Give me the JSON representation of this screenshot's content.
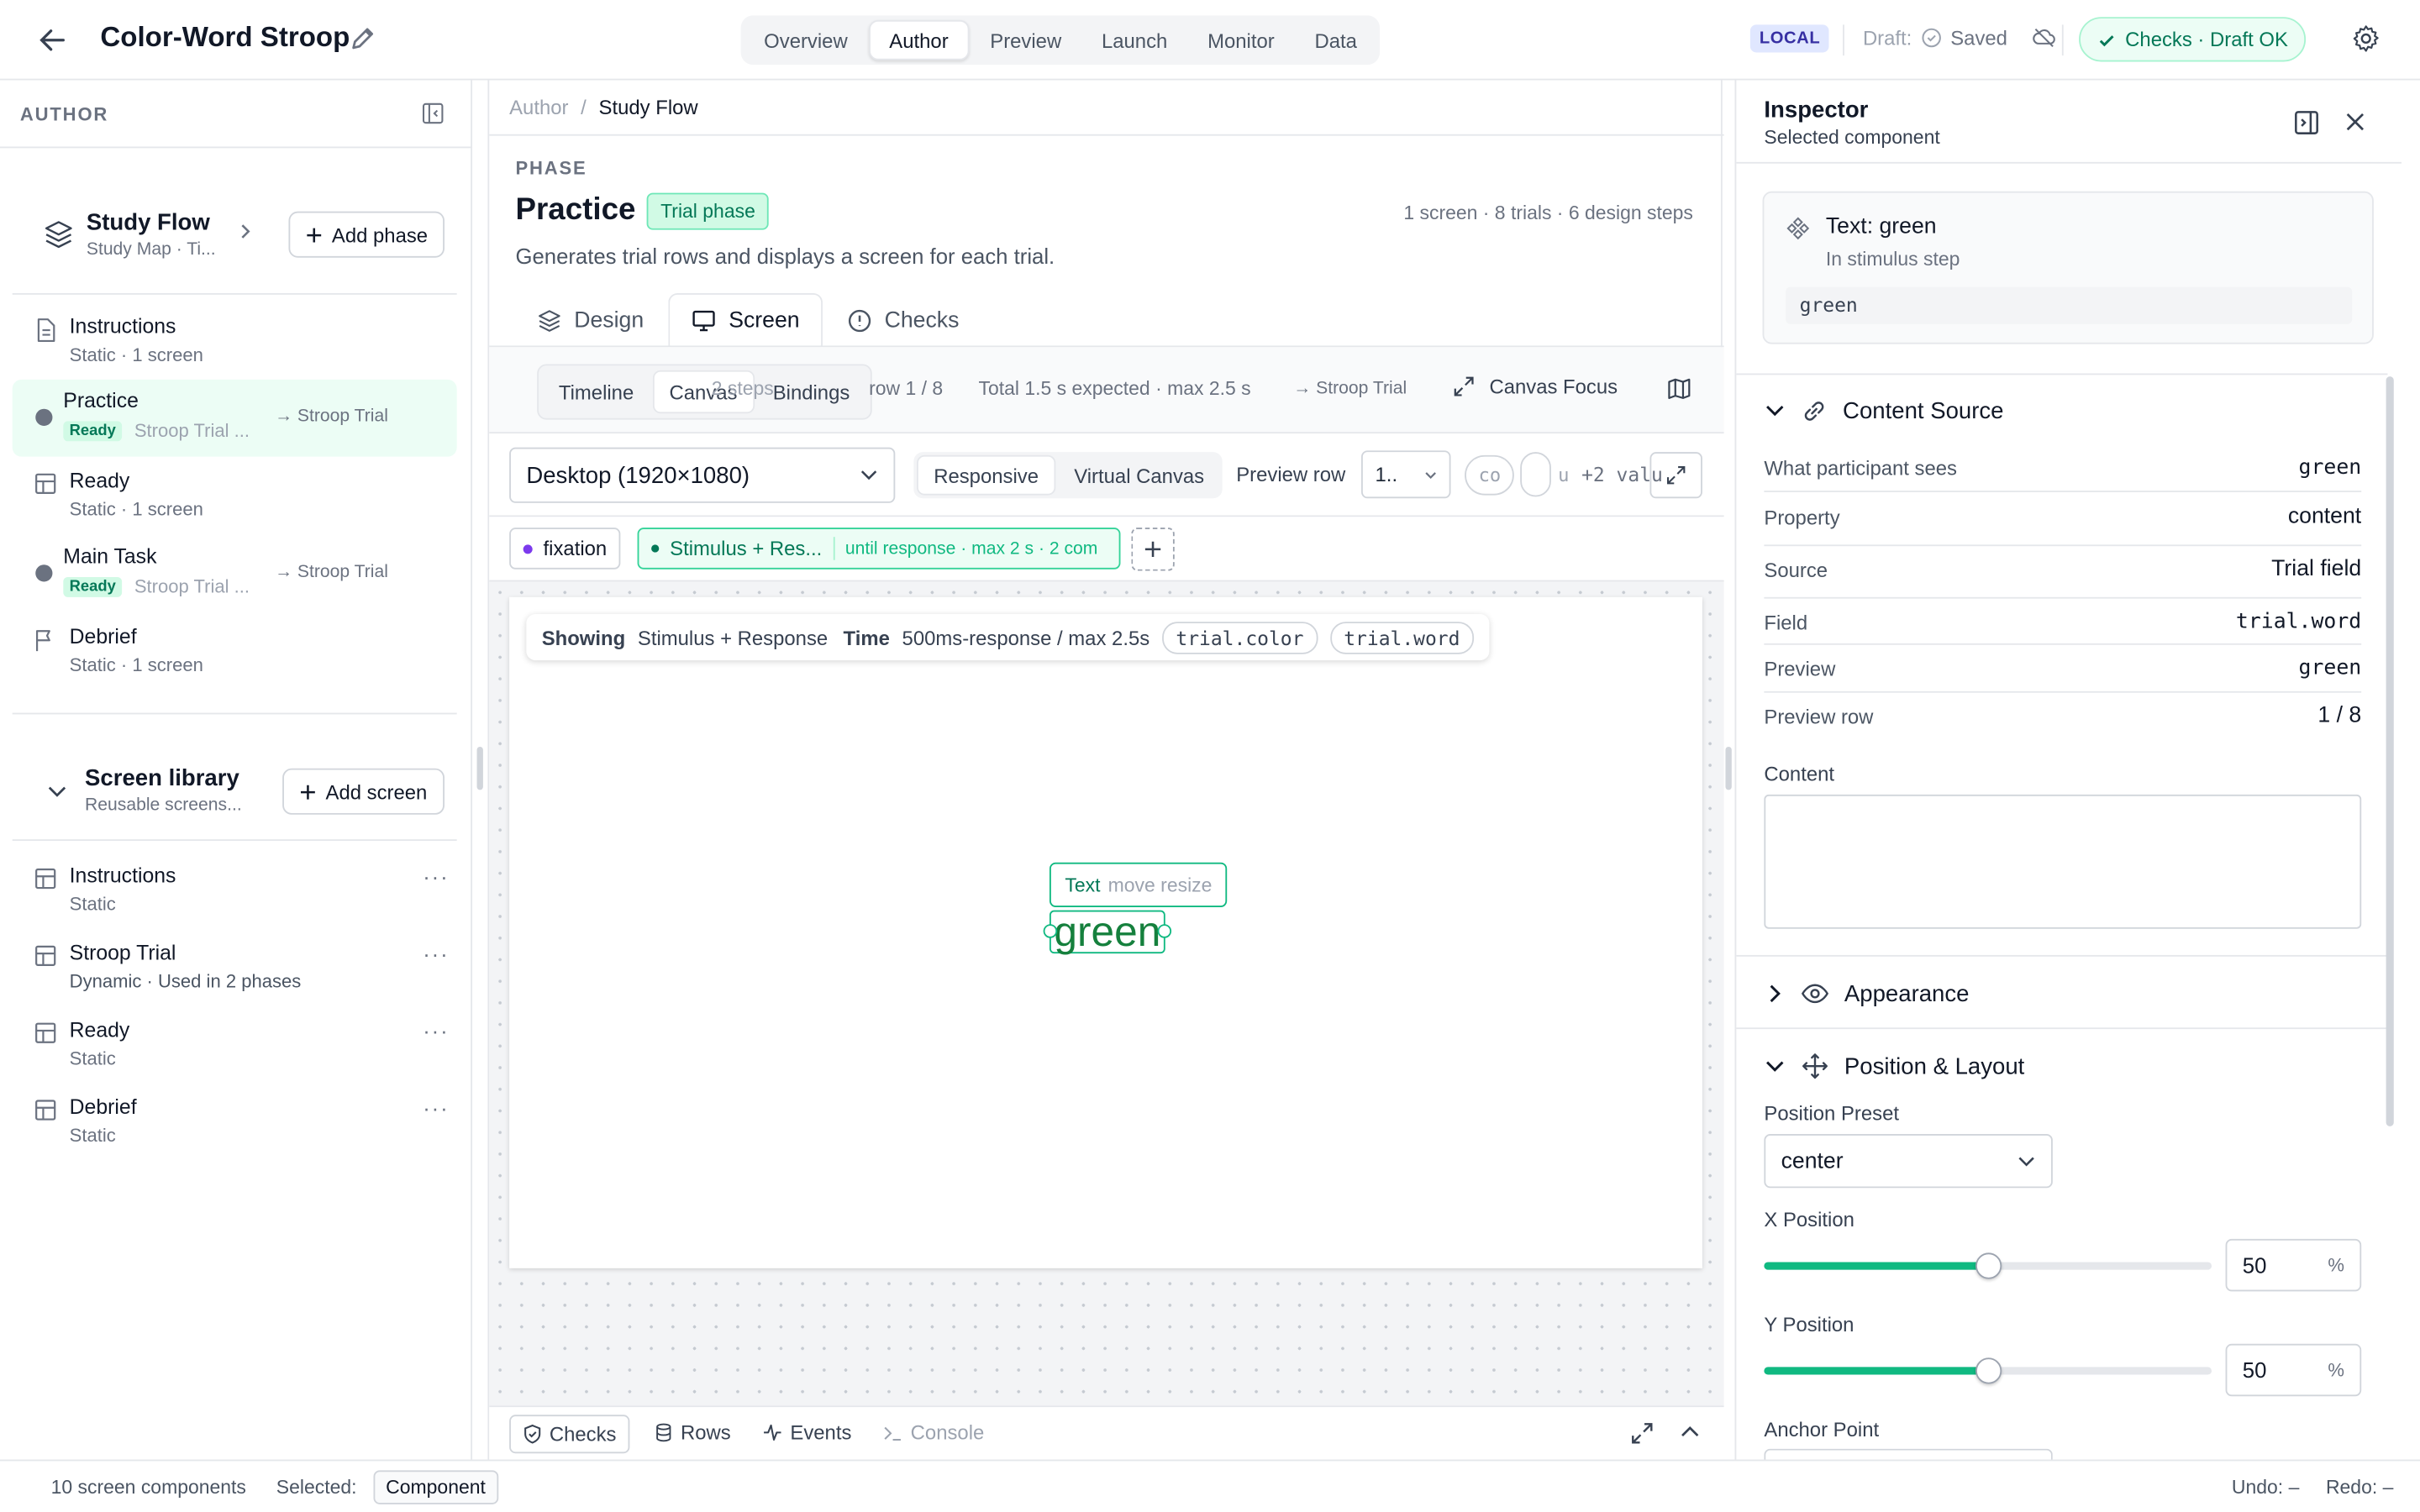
{
  "app": {
    "title": "Color-Word Stroop",
    "nav_tabs": [
      "Overview",
      "Author",
      "Preview",
      "Launch",
      "Monitor",
      "Data"
    ],
    "active_tab": "Author",
    "env_badge": "LOCAL",
    "draft_label": "Draft:",
    "saved_label": "Saved",
    "checks_label": "Checks · Draft OK"
  },
  "sidebar": {
    "header": "AUTHOR",
    "study_flow": {
      "title": "Study Flow",
      "subtitle": "Study Map · Ti...",
      "add_label": "Add phase"
    },
    "phases": [
      {
        "title": "Instructions",
        "subtitle": "Static · 1 screen",
        "icon": "document-icon"
      },
      {
        "title": "Practice",
        "badge": "Ready",
        "subtitle": "Stroop Trial ...",
        "link": "→ Stroop Trial",
        "icon": "dot-icon"
      },
      {
        "title": "Ready",
        "subtitle": "Static · 1 screen",
        "icon": "layout-icon"
      },
      {
        "title": "Main Task",
        "badge": "Ready",
        "subtitle": "Stroop Trial ...",
        "link": "→ Stroop Trial",
        "icon": "dot-icon"
      },
      {
        "title": "Debrief",
        "subtitle": "Static · 1 screen",
        "icon": "flag-icon"
      }
    ],
    "library": {
      "title": "Screen library",
      "subtitle": "Reusable screens...",
      "add_label": "Add screen",
      "items": [
        {
          "title": "Instructions",
          "subtitle": "Static"
        },
        {
          "title": "Stroop Trial",
          "subtitle": "Dynamic · Used in 2 phases"
        },
        {
          "title": "Ready",
          "subtitle": "Static"
        },
        {
          "title": "Debrief",
          "subtitle": "Static"
        }
      ]
    }
  },
  "center": {
    "breadcrumb": [
      "Author",
      "Study Flow"
    ],
    "kicker": "PHASE",
    "title": "Practice",
    "badge": "Trial phase",
    "stats": "1 screen · 8 trials · 6 design steps",
    "description": "Generates trial rows and displays a screen for each trial.",
    "subtabs": [
      "Design",
      "Screen",
      "Checks"
    ],
    "active_subtab": "Screen",
    "toolbar": {
      "seg": [
        "Timeline",
        "Canvas",
        "Bindings"
      ],
      "active_seg": "Canvas",
      "steps_text": "2 steps",
      "row_text": "row 1 / 8",
      "total_text": "Total 1.5 s expected · max 2.5 s",
      "link_text": "→ Stroop Trial",
      "focus_label": "Canvas Focus"
    },
    "display": {
      "device": "Desktop (1920×1080)",
      "responsive": "Responsive",
      "virtual": "Virtual Canvas",
      "preview_row_label": "Preview row",
      "preview_row_value": "1..",
      "truncated_1": "co",
      "truncated_2": "u",
      "more_values": "+2 valu"
    },
    "steps": {
      "fixation": "fixation",
      "stimulus": "Stimulus + Res...",
      "stimulus_meta": "until response · max 2 s · 2 com"
    },
    "canvas": {
      "showing_label": "Showing",
      "showing_value": "Stimulus + Response",
      "time_label": "Time",
      "time_value": "500ms-response / max 2.5s",
      "chips": [
        "trial.color",
        "trial.word"
      ],
      "text_handle": "Text",
      "text_handle_hint": "move resize",
      "stimulus_text": "green"
    },
    "bottom_tabs": [
      "Checks",
      "Rows",
      "Events",
      "Console"
    ]
  },
  "inspector": {
    "title": "Inspector",
    "subtitle": "Selected component",
    "component": {
      "name": "Text: green",
      "context": "In stimulus step",
      "value": "green"
    },
    "content_source": {
      "title": "Content Source",
      "rows": [
        {
          "label": "What participant sees",
          "value": "green"
        },
        {
          "label": "Property",
          "value": "content"
        },
        {
          "label": "Source",
          "value": "Trial field"
        },
        {
          "label": "Field",
          "value": "trial.word"
        },
        {
          "label": "Preview",
          "value": "green"
        },
        {
          "label": "Preview row",
          "value": "1 / 8"
        }
      ],
      "content_label": "Content"
    },
    "appearance_title": "Appearance",
    "position": {
      "title": "Position & Layout",
      "preset_label": "Position Preset",
      "preset_value": "center",
      "x_label": "X Position",
      "x_value": "50",
      "y_label": "Y Position",
      "y_value": "50",
      "unit": "%",
      "anchor_label": "Anchor Point"
    }
  },
  "status": {
    "components": "10 screen components",
    "selected_label": "Selected:",
    "selected_value": "Component",
    "undo": "Undo: –",
    "redo": "Redo: –"
  },
  "colors": {
    "accent": "#10b981",
    "accent_dark": "#047857",
    "stimulus_text": "#15803d"
  }
}
